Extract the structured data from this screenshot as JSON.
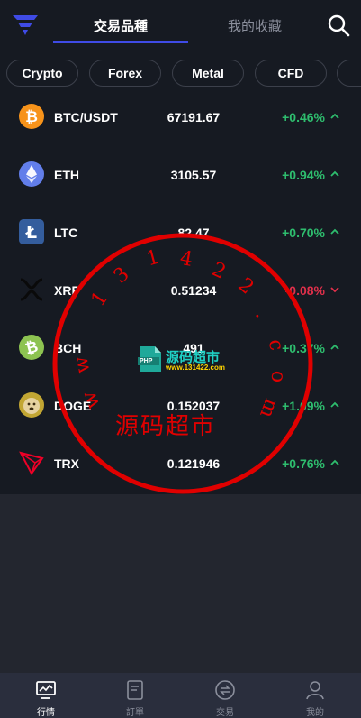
{
  "header": {
    "tabs": [
      "交易品種",
      "我的收藏"
    ],
    "active_tab": 0
  },
  "categories": [
    "Crypto",
    "Forex",
    "Metal",
    "CFD",
    ""
  ],
  "markets": [
    {
      "symbol": "BTC/USDT",
      "price": "67191.67",
      "change": "+0.46%",
      "direction": "up",
      "icon": "bitcoin-icon",
      "color": "#f7931a"
    },
    {
      "symbol": "ETH",
      "price": "3105.57",
      "change": "+0.94%",
      "direction": "up",
      "icon": "ethereum-icon",
      "color": "#627eea"
    },
    {
      "symbol": "LTC",
      "price": "82.47",
      "change": "+0.70%",
      "direction": "up",
      "icon": "litecoin-icon",
      "color": "#345d9d"
    },
    {
      "symbol": "XRP",
      "price": "0.51234",
      "change": "-0.08%",
      "direction": "down",
      "icon": "xrp-icon",
      "color": "#000000"
    },
    {
      "symbol": "BCH",
      "price": "491",
      "change": "+0.37%",
      "direction": "up",
      "icon": "bitcoin-cash-icon",
      "color": "#8dc351"
    },
    {
      "symbol": "DOGE",
      "price": "0.152037",
      "change": "+1.09%",
      "direction": "up",
      "icon": "dogecoin-icon",
      "color": "#c2a633"
    },
    {
      "symbol": "TRX",
      "price": "0.121946",
      "change": "+0.76%",
      "direction": "up",
      "icon": "tron-icon",
      "color": "#ef0027"
    }
  ],
  "bottom_nav": [
    {
      "label": "行情",
      "icon": "chart-monitor-icon",
      "active": true
    },
    {
      "label": "訂單",
      "icon": "document-icon",
      "active": false
    },
    {
      "label": "交易",
      "icon": "exchange-icon",
      "active": false
    },
    {
      "label": "我的",
      "icon": "user-icon",
      "active": false
    }
  ],
  "watermark": {
    "digits": [
      "w",
      "w",
      "1",
      "3",
      "1",
      "4",
      "2",
      "2",
      ".",
      "c",
      "o",
      "m"
    ],
    "brand": "源码超市",
    "badge_title": "源码超市",
    "badge_url": "www.131422.com",
    "badge_icon_text": "PHP"
  },
  "colors": {
    "up": "#2ebd6e",
    "down": "#e0304b",
    "accent": "#3f4be6",
    "watermark": "#e00000"
  }
}
